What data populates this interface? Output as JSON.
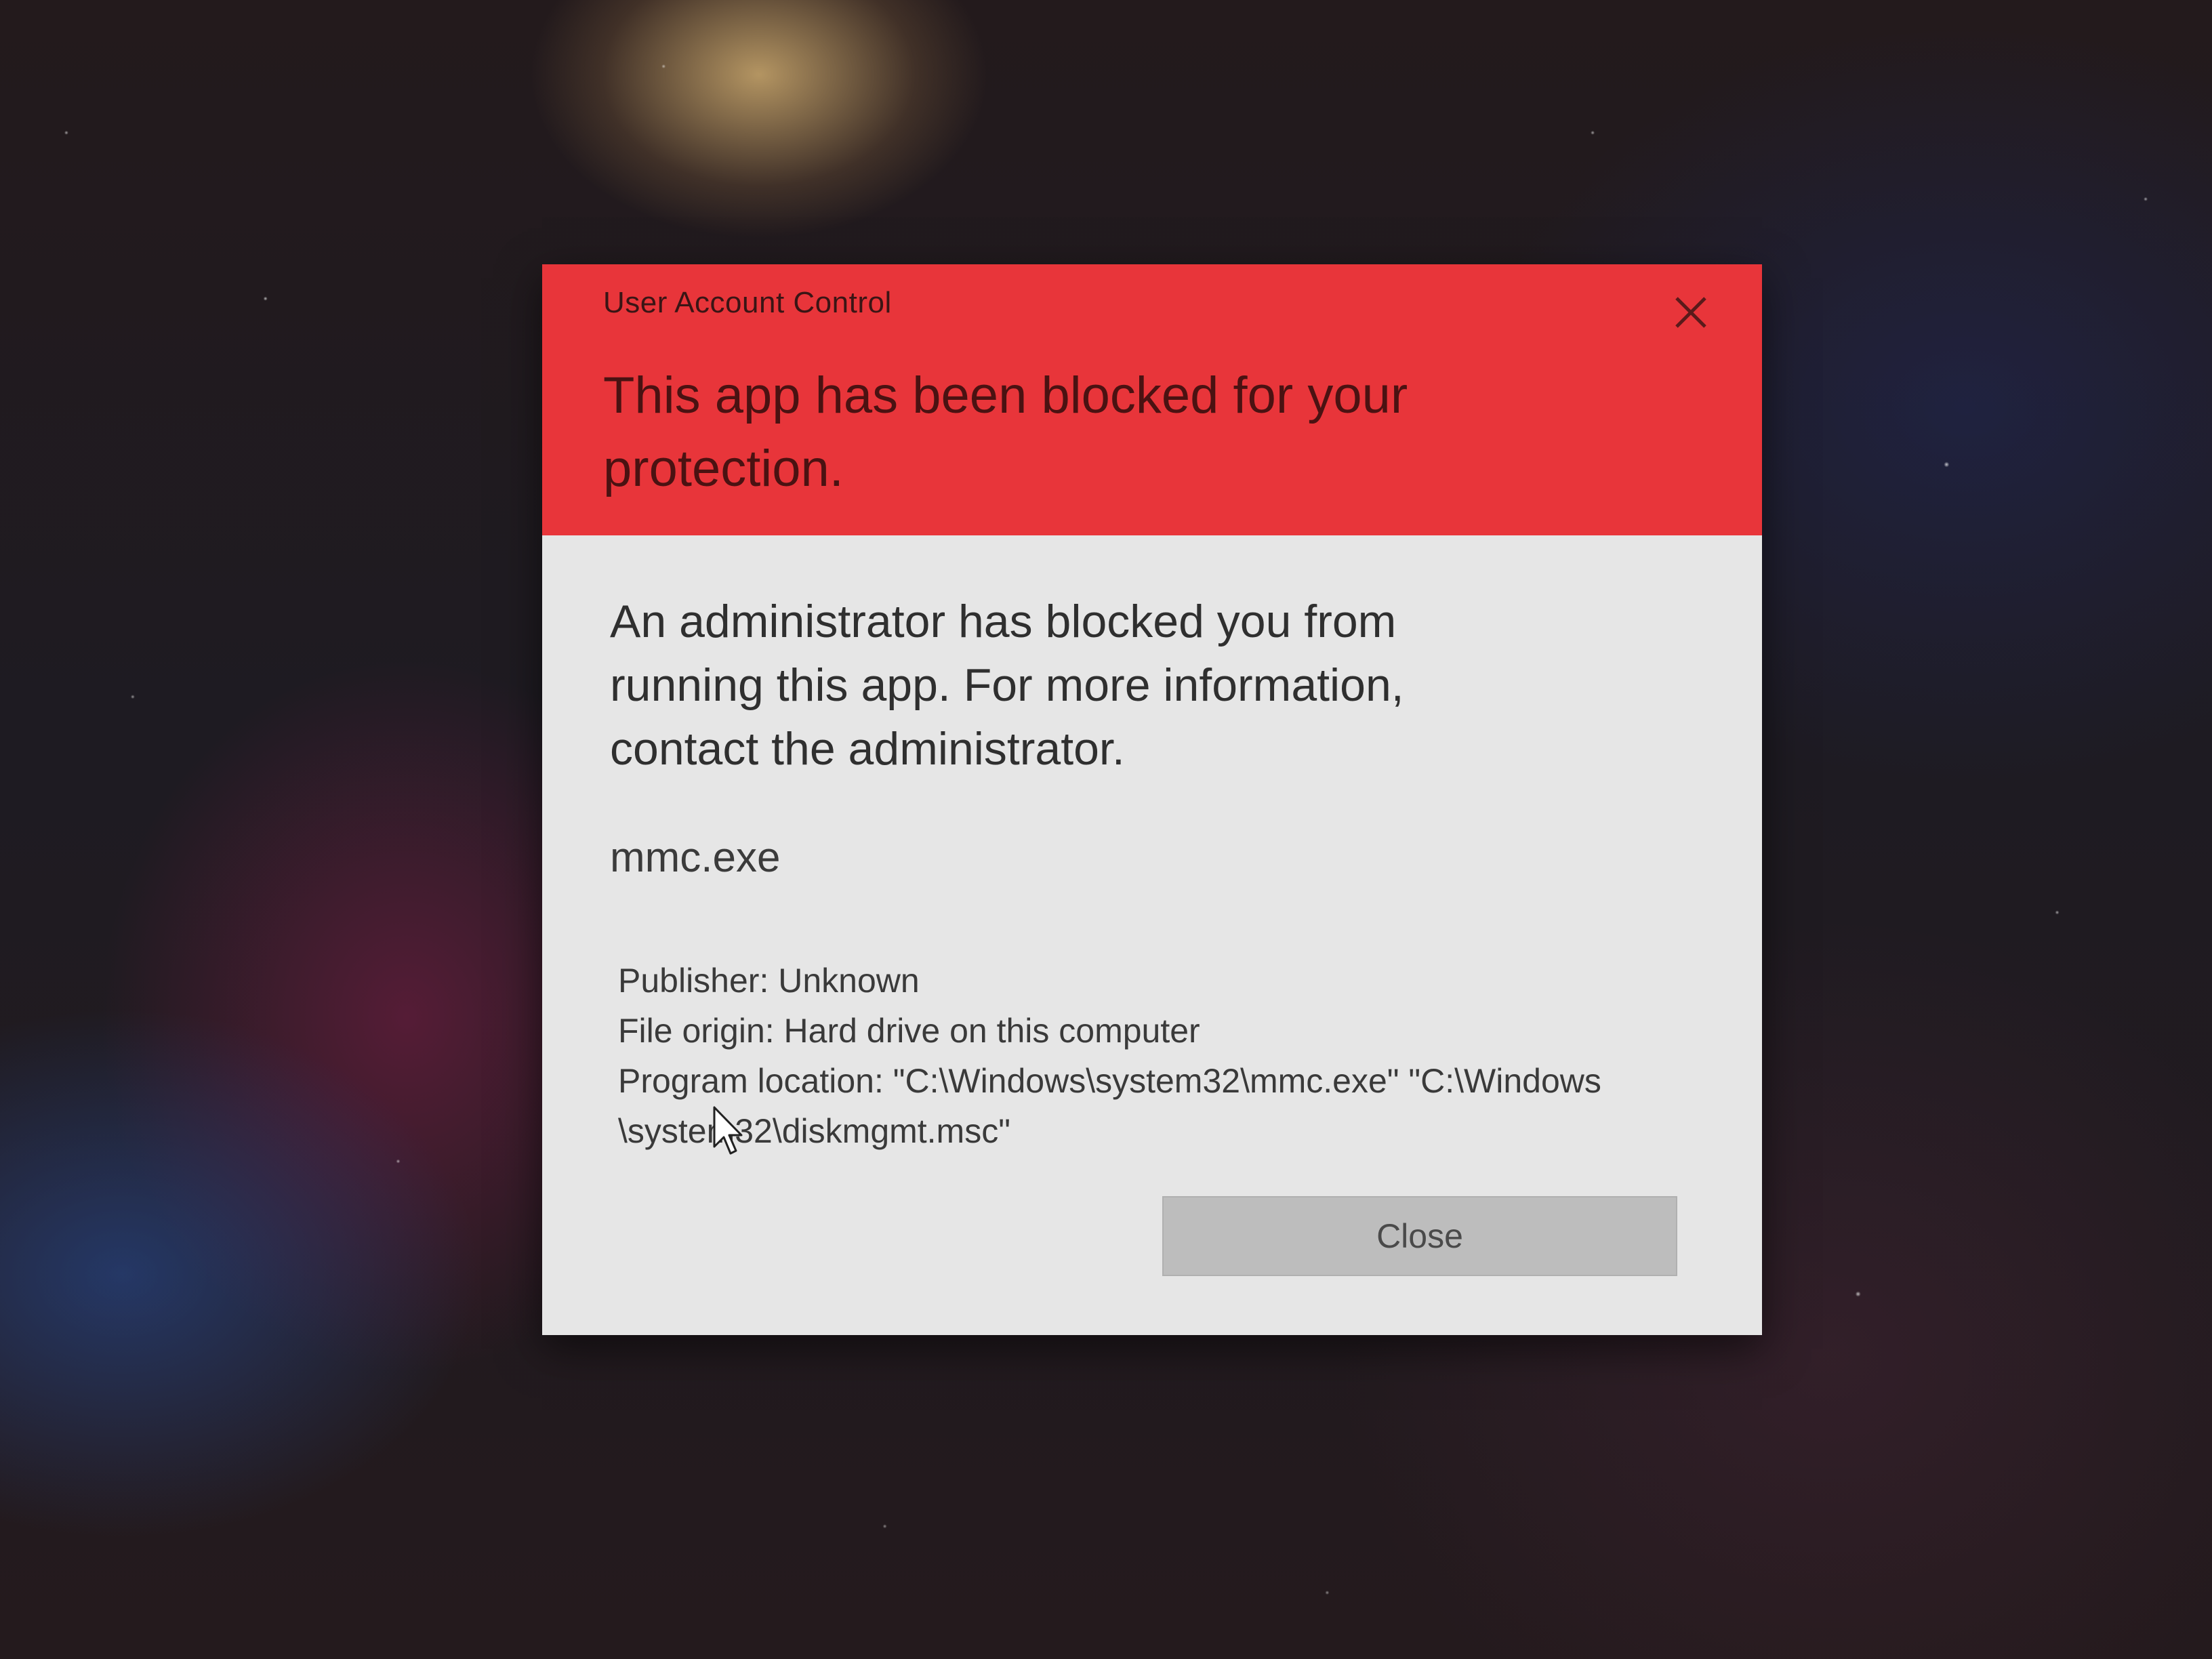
{
  "dialog": {
    "window_title": "User Account Control",
    "headline": "This app has been blocked for your protection.",
    "message": "An administrator has blocked you from running this app. For more information, contact the administrator.",
    "app_name": "mmc.exe",
    "publisher": "Publisher: Unknown",
    "file_origin": "File origin: Hard drive on this computer",
    "program_location_line1": "Program location: \"C:\\Windows\\system32\\mmc.exe\" \"C:\\Windows",
    "program_location_line2": "\\system32\\diskmgmt.msc\"",
    "close_button_label": "Close",
    "close_icon": "close-x-icon"
  },
  "colors": {
    "header_red": "#e8353a",
    "body_gray": "#e6e6e6",
    "button_gray": "#bdbdbd"
  }
}
